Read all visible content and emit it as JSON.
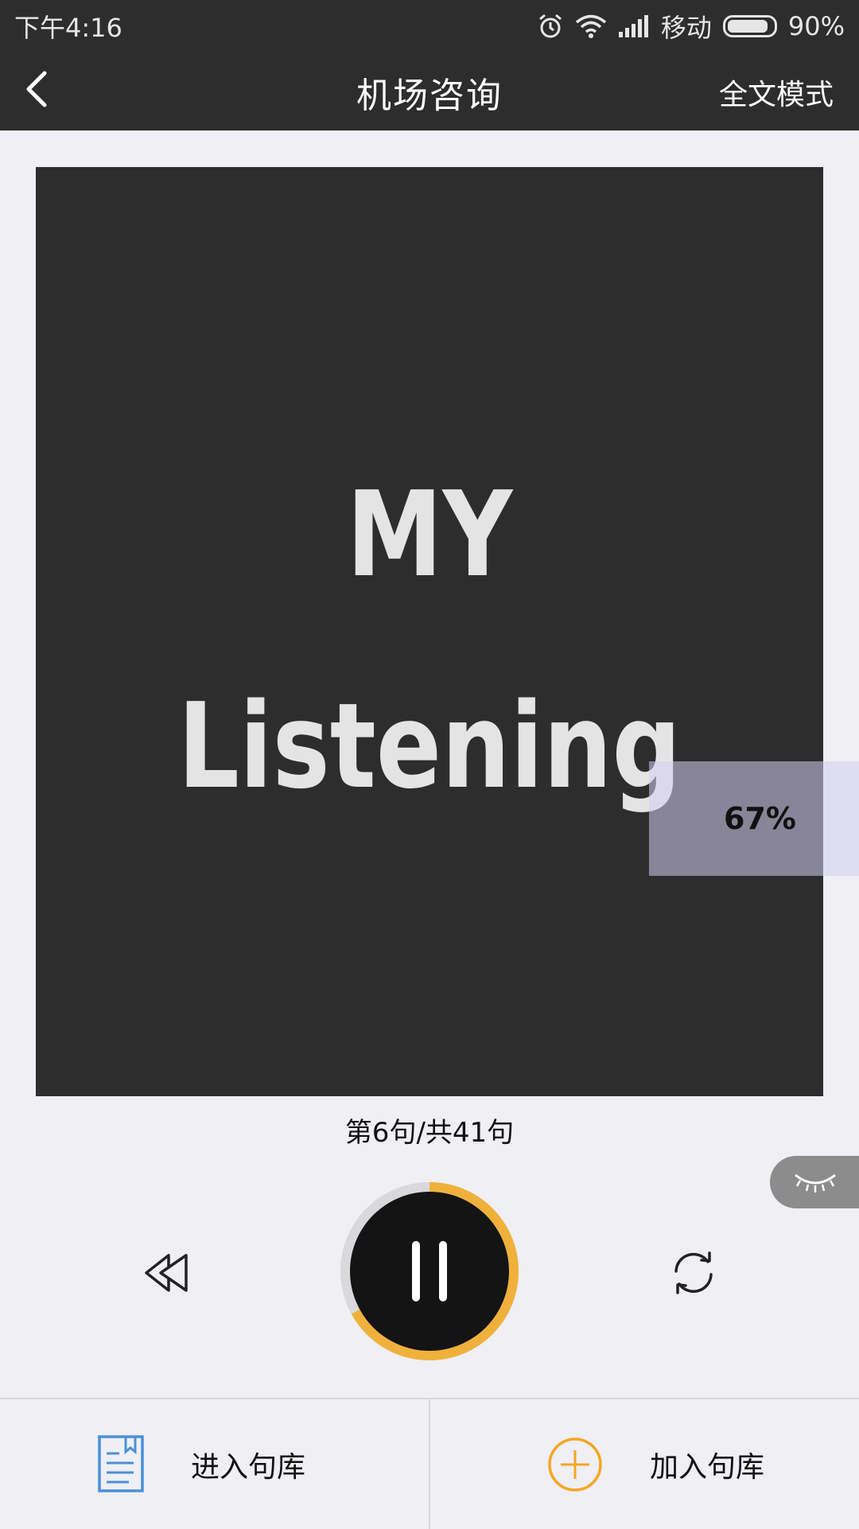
{
  "status_bar": {
    "time": "下午4:16",
    "carrier": "移动",
    "battery": "90%",
    "battery_level": 0.9,
    "icons": [
      "alarm-icon",
      "wifi-icon",
      "signal-icon",
      "battery-icon"
    ]
  },
  "nav": {
    "title": "机场咨询",
    "full_mode": "全文模式",
    "back_icon": "chevron-left-icon"
  },
  "media": {
    "line1": "MY",
    "line2": "Listening",
    "percent": "67%",
    "eye_icon": "closed-eye-icon"
  },
  "player": {
    "counter": "第6句/共41句",
    "progress": 0.67,
    "accent": "#f0b13c",
    "icons": [
      "rewind-icon",
      "pause-icon",
      "loop-icon"
    ]
  },
  "bottom": {
    "enter_library": "进入句库",
    "add_library": "加入句库",
    "book_icon": "book-icon",
    "plus_icon": "plus-circle-icon",
    "book_color": "#4a90d9",
    "plus_color": "#f5a623"
  }
}
